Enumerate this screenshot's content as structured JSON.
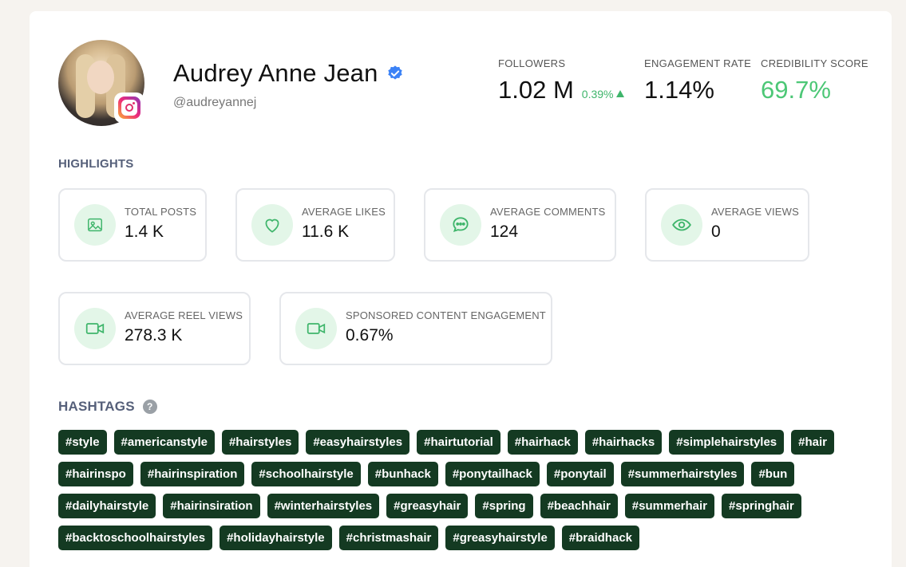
{
  "profile": {
    "name": "Audrey Anne Jean",
    "handle": "@audreyannej",
    "platform_icon": "instagram-icon",
    "verified": true
  },
  "stats": {
    "followers": {
      "label": "FOLLOWERS",
      "value": "1.02 M",
      "delta": "0.39%"
    },
    "engagement_rate": {
      "label": "ENGAGEMENT RATE",
      "value": "1.14%"
    },
    "credibility_score": {
      "label": "CREDIBILITY SCORE",
      "value": "69.7%"
    }
  },
  "highlights": {
    "title": "HIGHLIGHTS",
    "items": [
      {
        "label": "TOTAL POSTS",
        "value": "1.4 K",
        "icon": "image-icon"
      },
      {
        "label": "AVERAGE LIKES",
        "value": "11.6 K",
        "icon": "heart-icon"
      },
      {
        "label": "AVERAGE COMMENTS",
        "value": "124",
        "icon": "comment-icon"
      },
      {
        "label": "AVERAGE VIEWS",
        "value": "0",
        "icon": "eye-icon"
      },
      {
        "label": "AVERAGE REEL VIEWS",
        "value": "278.3 K",
        "icon": "video-icon"
      },
      {
        "label": "SPONSORED CONTENT ENGAGEMENT",
        "value": "0.67%",
        "icon": "video-icon"
      }
    ]
  },
  "hashtags": {
    "title": "HASHTAGS",
    "help_icon": "?",
    "items": [
      "#style",
      "#americanstyle",
      "#hairstyles",
      "#easyhairstyles",
      "#hairtutorial",
      "#hairhack",
      "#hairhacks",
      "#simplehairstyles",
      "#hair",
      "#hairinspo",
      "#hairinspiration",
      "#schoolhairstyle",
      "#bunhack",
      "#ponytailhack",
      "#ponytail",
      "#summerhairstyles",
      "#bun",
      "#dailyhairstyle",
      "#hairinsiration",
      "#winterhairstyles",
      "#greasyhair",
      "#spring",
      "#beachhair",
      "#summerhair",
      "#springhair",
      "#backtoschoolhairstyles",
      "#holidayhairstyle",
      "#christmashair",
      "#greasyhairstyle",
      "#braidhack"
    ]
  },
  "colors": {
    "accent_green": "#4cc776",
    "icon_bg": "#e3f6e8",
    "tag_bg": "#143a22",
    "verified_blue": "#3b82f6"
  }
}
